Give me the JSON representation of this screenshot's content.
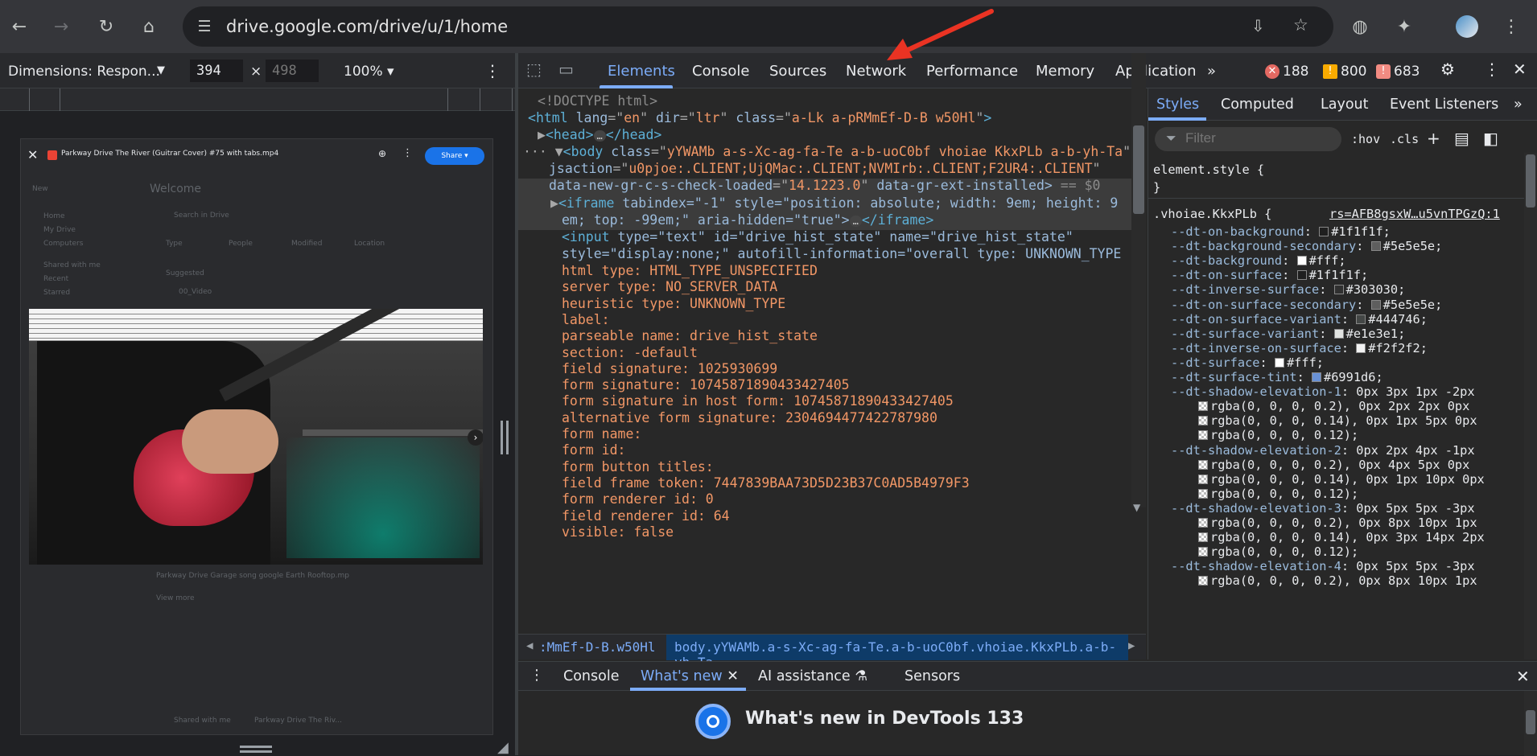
{
  "browser": {
    "url": "drive.google.com/drive/u/1/home",
    "icons": [
      "back-icon",
      "forward-icon",
      "reload-icon",
      "home-icon",
      "site-info-icon",
      "install-icon",
      "bookmark-star-icon",
      "translate-icon",
      "extensions-icon",
      "profile-avatar",
      "more-vert-icon"
    ]
  },
  "device_toolbar": {
    "dimensions_label": "Dimensions: Respon...",
    "width": "394",
    "height_placeholder": "498",
    "x": "×",
    "zoom": "100%"
  },
  "viewer": {
    "title": "Parkway Drive The River (Guitrar Cover) #75 with tabs.mp4",
    "share": "Share",
    "ghost": {
      "new": "New",
      "welcome": "Welcome",
      "search": "Search in Drive",
      "home": "Home",
      "my_drive": "My Drive",
      "computers": "Computers",
      "shared": "Shared with me",
      "recent": "Recent",
      "starred": "Starred",
      "type": "Type",
      "people": "People",
      "modified": "Modified",
      "location": "Location",
      "suggested": "Suggested",
      "folder": "00_Video",
      "file_row": "Parkway Drive Garage song google Earth Rooftop.mp",
      "view_more": "View more",
      "bottom_1": "Shared with me",
      "bottom_2": "Parkway Drive The Riv..."
    }
  },
  "devtools": {
    "tabs": [
      "Elements",
      "Console",
      "Sources",
      "Network",
      "Performance",
      "Memory",
      "Application"
    ],
    "more_tabs": "»",
    "errors": "188",
    "warnings": "800",
    "issues": "683",
    "dom": {
      "doctype": "<!DOCTYPE html>",
      "html_open": {
        "tag": "html",
        "lang": "en",
        "dir": "ltr",
        "class": "a-Lk a-pRMmEf-D-B w50Hl"
      },
      "head": {
        "open": "<head>",
        "close": "</head>",
        "ellipsis": "…"
      },
      "body_class": "yYWAMb a-s-Xc-ag-fa-Te a-b-uoC0bf vhoiae KkxPLb a-b-yh-Ta",
      "body_jsaction": "u0pjoe:.CLIENT;UjQMac:.CLIENT;NVMIrb:.CLIENT;F2UR4:.CLIENT",
      "body_checkloaded": "14.1223.0",
      "body_tail": "data-gr-ext-installed>",
      "body_eq": " == $0",
      "iframe_l1": "tabindex=\"-1\" style=\"position: absolute; width: 9em; height: 9",
      "iframe_l2": "em; top: -99em;\" aria-hidden=\"true\">",
      "iframe_close": "</iframe>",
      "input_l1": "type=\"text\" id=\"drive_hist_state\" name=\"drive_hist_state\"",
      "input_l2": "style=\"display:none;\" autofill-information=\"overall type: UNKNOWN_TYPE",
      "autofill_lines": [
        "html type: HTML_TYPE_UNSPECIFIED",
        "server type: NO_SERVER_DATA",
        "heuristic type: UNKNOWN_TYPE",
        "label:",
        "parseable name: drive_hist_state",
        "section: -default",
        "field signature: 1025930699",
        "form signature: 10745871890433427405",
        "form signature in host form: 10745871890433427405",
        "alternative form signature: 2304694477422787980",
        "form name:",
        "form id:",
        "form button titles:",
        "field frame token: 7447839BAA73D5D23B37C0AD5B4979F3",
        "form renderer id: 0",
        "field renderer id: 64",
        "visible: false"
      ]
    },
    "breadcrumb": {
      "item1": ":MmEf-D-B.w50Hl",
      "item2": "body.yYWAMb.a-s-Xc-ag-fa-Te.a-b-uoC0bf.vhoiae.KkxPLb.a-b-yh-Ta"
    },
    "styles": {
      "tabs": [
        "Styles",
        "Computed",
        "Layout",
        "Event Listeners"
      ],
      "more": "»",
      "filter_placeholder": "Filter",
      "hov": ":hov",
      "cls": ".cls",
      "element_style": "element.style {",
      "close_brace": "}",
      "selector": ".vhoiae.KkxPLb {",
      "source": "rs=AFB8gsxW…u5vnTPGzQ:1",
      "props": [
        {
          "name": "--dt-on-background",
          "value": "#1f1f1f",
          "swatch": "#1f1f1f"
        },
        {
          "name": "--dt-background-secondary",
          "value": "#5e5e5e",
          "swatch": "#5e5e5e"
        },
        {
          "name": "--dt-background",
          "value": "#fff",
          "swatch": "#ffffff"
        },
        {
          "name": "--dt-on-surface",
          "value": "#1f1f1f",
          "swatch": "#1f1f1f"
        },
        {
          "name": "--dt-inverse-surface",
          "value": "#303030",
          "swatch": "#303030"
        },
        {
          "name": "--dt-on-surface-secondary",
          "value": "#5e5e5e",
          "swatch": "#5e5e5e"
        },
        {
          "name": "--dt-on-surface-variant",
          "value": "#444746",
          "swatch": "#444746"
        },
        {
          "name": "--dt-surface-variant",
          "value": "#e1e3e1",
          "swatch": "#e1e3e1"
        },
        {
          "name": "--dt-inverse-on-surface",
          "value": "#f2f2f2",
          "swatch": "#f2f2f2"
        },
        {
          "name": "--dt-surface",
          "value": "#fff",
          "swatch": "#ffffff"
        },
        {
          "name": "--dt-surface-tint",
          "value": "#6991d6",
          "swatch": "#6991d6"
        }
      ],
      "shadows": [
        {
          "name": "--dt-shadow-elevation-1",
          "first": "0px 3px 1px -2px",
          "lines": [
            "rgba(0, 0, 0, 0.2), 0px 2px 2px 0px",
            "rgba(0, 0, 0, 0.14), 0px 1px 5px 0px",
            "rgba(0, 0, 0, 0.12);"
          ]
        },
        {
          "name": "--dt-shadow-elevation-2",
          "first": "0px 2px 4px -1px",
          "lines": [
            "rgba(0, 0, 0, 0.2), 0px 4px 5px 0px",
            "rgba(0, 0, 0, 0.14), 0px 1px 10px 0px",
            "rgba(0, 0, 0, 0.12);"
          ]
        },
        {
          "name": "--dt-shadow-elevation-3",
          "first": "0px 5px 5px -3px",
          "lines": [
            "rgba(0, 0, 0, 0.2), 0px 8px 10px 1px",
            "rgba(0, 0, 0, 0.14), 0px 3px 14px 2px",
            "rgba(0, 0, 0, 0.12);"
          ]
        },
        {
          "name": "--dt-shadow-elevation-4",
          "first": "0px 5px 5px -3px",
          "lines": [
            "rgba(0, 0, 0, 0.2), 0px 8px 10px 1px"
          ]
        }
      ]
    },
    "drawer": {
      "tabs": [
        "Console",
        "What's new",
        "AI assistance",
        "Sensors"
      ],
      "title": "What's new in DevTools 133"
    }
  },
  "colors": {
    "accent": "#7cacf8",
    "error": "#e46962",
    "warning": "#f9ab00",
    "issue": "#f28b82",
    "annotation_arrow": "#ea3323"
  }
}
